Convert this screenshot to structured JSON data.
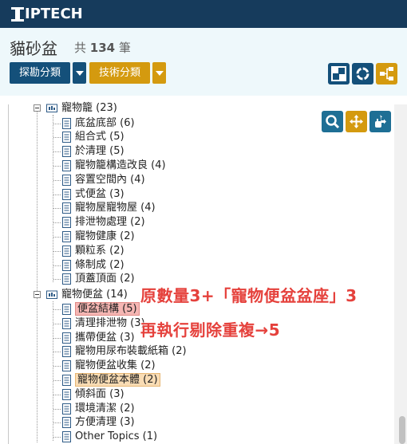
{
  "brand": {
    "name": "IPTECH"
  },
  "page": {
    "title": "貓砂盆",
    "count_prefix": "共",
    "count_value": "134",
    "count_suffix": "筆"
  },
  "toolbar": {
    "explore_label": "探勘分類",
    "tech_label": "技術分類",
    "colors": {
      "blue": "#14507a",
      "gold": "#d49a0f",
      "teal": "#1e6f95"
    }
  },
  "tree": {
    "group1": {
      "label": "寵物籠 (23)",
      "items": [
        "底盆底部 (6)",
        "組合式 (5)",
        "於清理 (5)",
        "寵物籠構造改良 (4)",
        "容置空間內 (4)",
        "式便盆 (3)",
        "寵物屋寵物屋 (4)",
        "排泄物處理 (2)",
        "寵物健康 (2)",
        "顆粒系 (2)",
        "條制成 (2)",
        "頂蓋頂面 (2)"
      ]
    },
    "group2": {
      "label": "寵物便盆 (14)",
      "items": [
        "便盆結構 (5)",
        "清理排泄物 (3)",
        "攜帶便盆 (3)",
        "寵物用尿布裝載紙箱 (2)",
        "寵物便盆收集 (2)",
        "寵物便盆本體 (2)",
        "傾斜面 (3)",
        "環境清潔 (2)",
        "方便清理 (3)",
        "Other Topics (1)"
      ]
    }
  },
  "annotation": {
    "line1": "原數量3+「寵物便盆盆座」3",
    "line2": "再執行剔除重複→5"
  }
}
